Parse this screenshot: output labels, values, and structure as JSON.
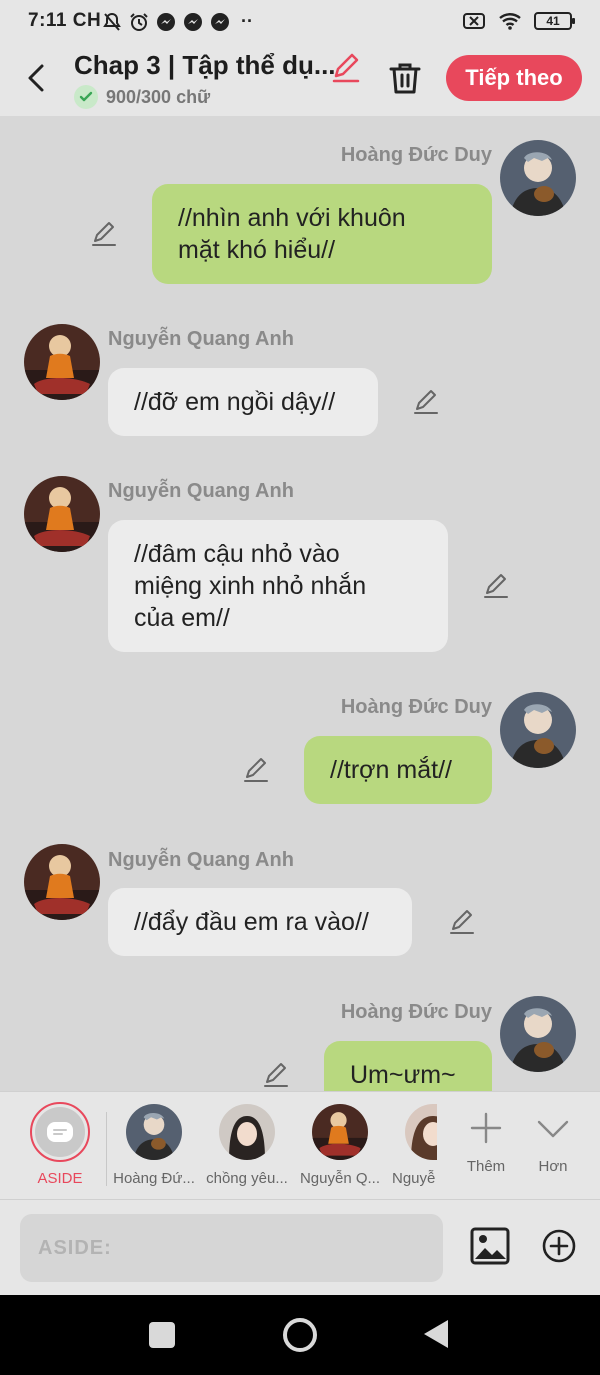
{
  "status_bar": {
    "time": "7:11 CH",
    "battery": "41",
    "more": "··"
  },
  "header": {
    "title": "Chap 3 | Tập thể dụ...",
    "word_count": "900/300 chữ",
    "next_label": "Tiếp theo"
  },
  "messages": [
    {
      "side": "right",
      "name": "Hoàng Đức Duy",
      "text_lines": [
        "//nhìn anh với khuôn",
        "mặt khó hiểu//"
      ]
    },
    {
      "side": "left",
      "name": "Nguyễn Quang Anh",
      "text_lines": [
        "//đỡ em ngồi dậy//"
      ]
    },
    {
      "side": "left",
      "name": "Nguyễn Quang Anh",
      "text_lines": [
        "//đâm cậu nhỏ vào",
        "miệng xinh nhỏ nhắn",
        "của em//"
      ]
    },
    {
      "side": "right",
      "name": "Hoàng Đức Duy",
      "text_lines": [
        "//trợn mắt//"
      ]
    },
    {
      "side": "left",
      "name": "Nguyễn Quang Anh",
      "text_lines": [
        "//đẩy đầu em ra vào//"
      ]
    },
    {
      "side": "right",
      "name": "Hoàng Đức Duy",
      "text_lines": [
        "Um~ưm~"
      ]
    }
  ],
  "character_bar": {
    "aside_label": "ASIDE",
    "characters": [
      {
        "label": "Hoàng Đứ..."
      },
      {
        "label": "chồng yêu..."
      },
      {
        "label": "Nguyễn Q..."
      },
      {
        "label": "Nguyễ"
      }
    ],
    "add_label": "Thêm",
    "more_label": "Hơn"
  },
  "input": {
    "placeholder": "ASIDE:"
  },
  "colors": {
    "accent": "#e8485c",
    "bubble_right": "#b8d87f",
    "bubble_left": "#ececec",
    "chat_bg": "#d7d7d7"
  }
}
